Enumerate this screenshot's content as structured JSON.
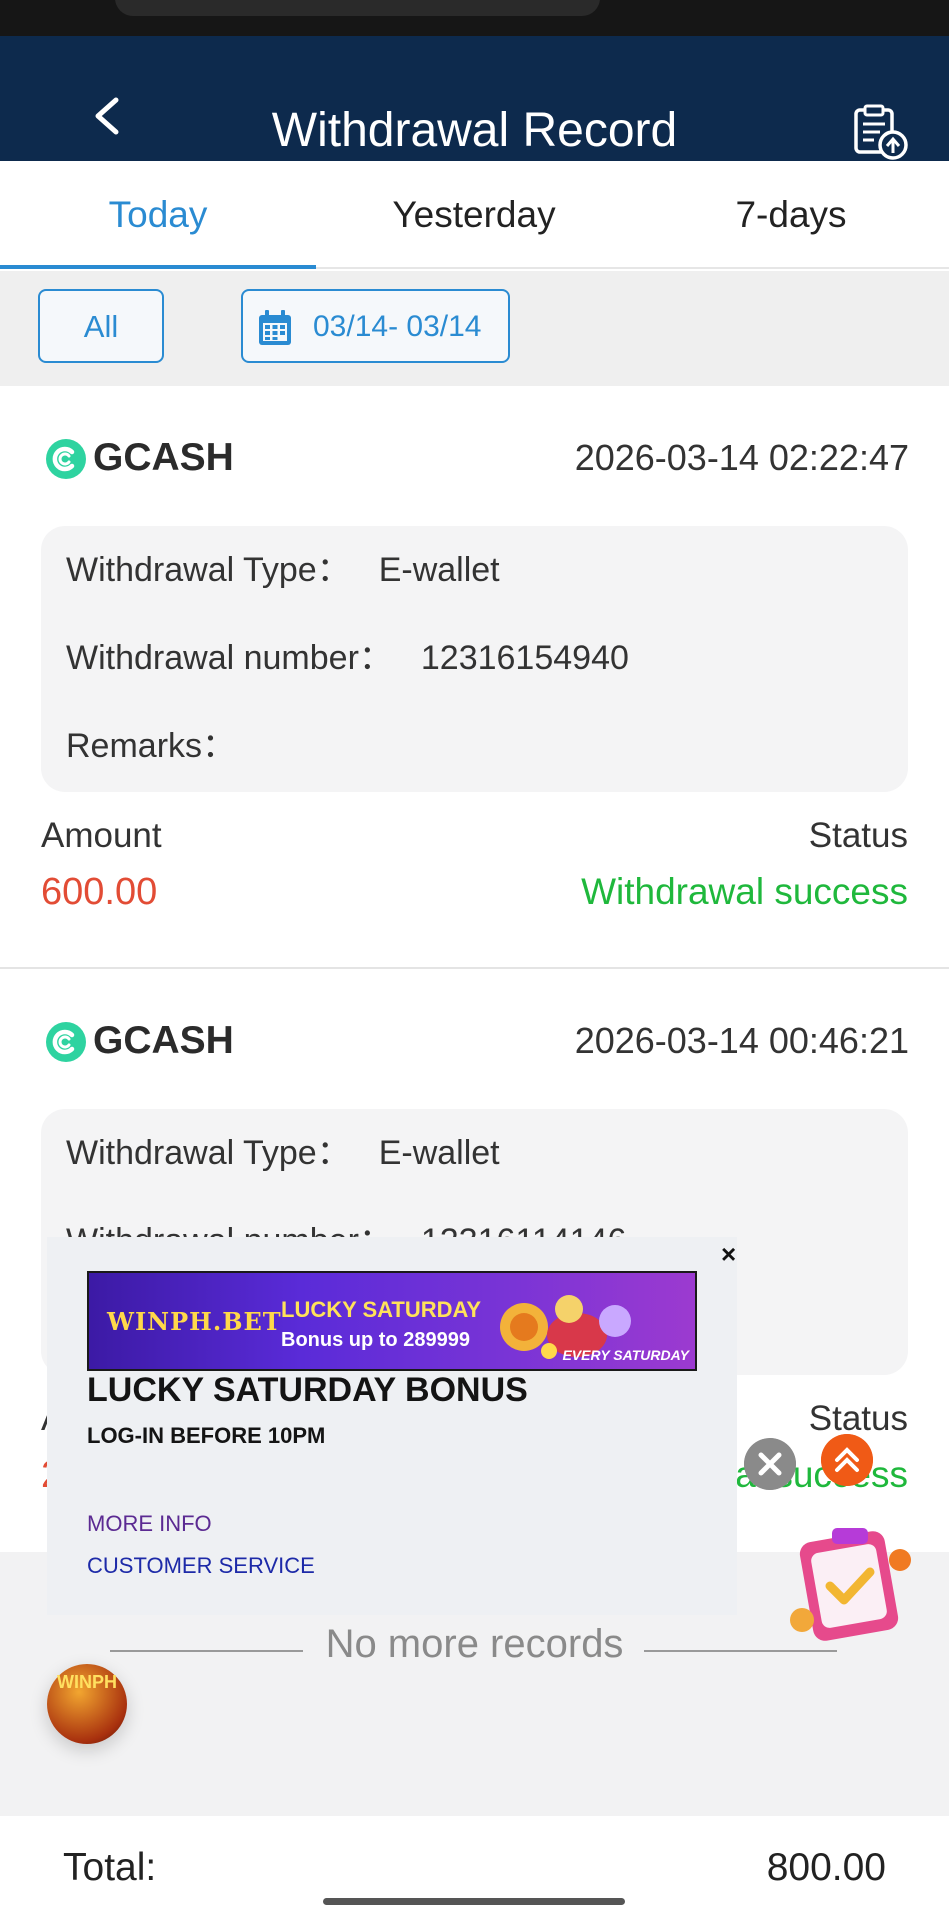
{
  "header": {
    "title": "Withdrawal Record"
  },
  "tabs": [
    {
      "label": "Today",
      "active": true
    },
    {
      "label": "Yesterday",
      "active": false
    },
    {
      "label": "7-days",
      "active": false
    }
  ],
  "filters": {
    "type_label": "All",
    "date_range": "03/14- 03/14"
  },
  "records": [
    {
      "method": "GCASH",
      "datetime": "2026-03-14 02:22:47",
      "type_label": "Withdrawal Type：",
      "type_value": "E-wallet",
      "number_label": "Withdrawal number：",
      "number_value": "12316154940",
      "remarks_label": "Remarks：",
      "amount_label": "Amount",
      "amount": "600.00",
      "status_label": "Status",
      "status": "Withdrawal success"
    },
    {
      "method": "GCASH",
      "datetime": "2026-03-14 00:46:21",
      "type_label": "Withdrawal Type：",
      "type_value": "E-wallet",
      "number_label": "Withdrawal number：",
      "number_value": "12316114146",
      "amount_label": "A",
      "amount": "2",
      "status_label": "Status",
      "status": "al success"
    }
  ],
  "no_more": "No more records",
  "footer": {
    "total_label": "Total:",
    "total_value": "800.00"
  },
  "popup": {
    "close": "×",
    "banner_brand": "WINPH.BET",
    "banner_title": "LUCKY SATURDAY",
    "banner_bonus": "Bonus up to 289999",
    "banner_tag": "EVERY SATURDAY",
    "title": "LUCKY SATURDAY BONUS",
    "subtitle": "LOG-IN BEFORE 10PM",
    "more_info": "MORE INFO",
    "customer_service": "CUSTOMER SERVICE"
  },
  "floating": {
    "winph_badge": "WINPH"
  },
  "colors": {
    "header_bg": "#0d2a4d",
    "accent": "#2a8bd2",
    "amount": "#e24c35",
    "success": "#1fb83c"
  }
}
